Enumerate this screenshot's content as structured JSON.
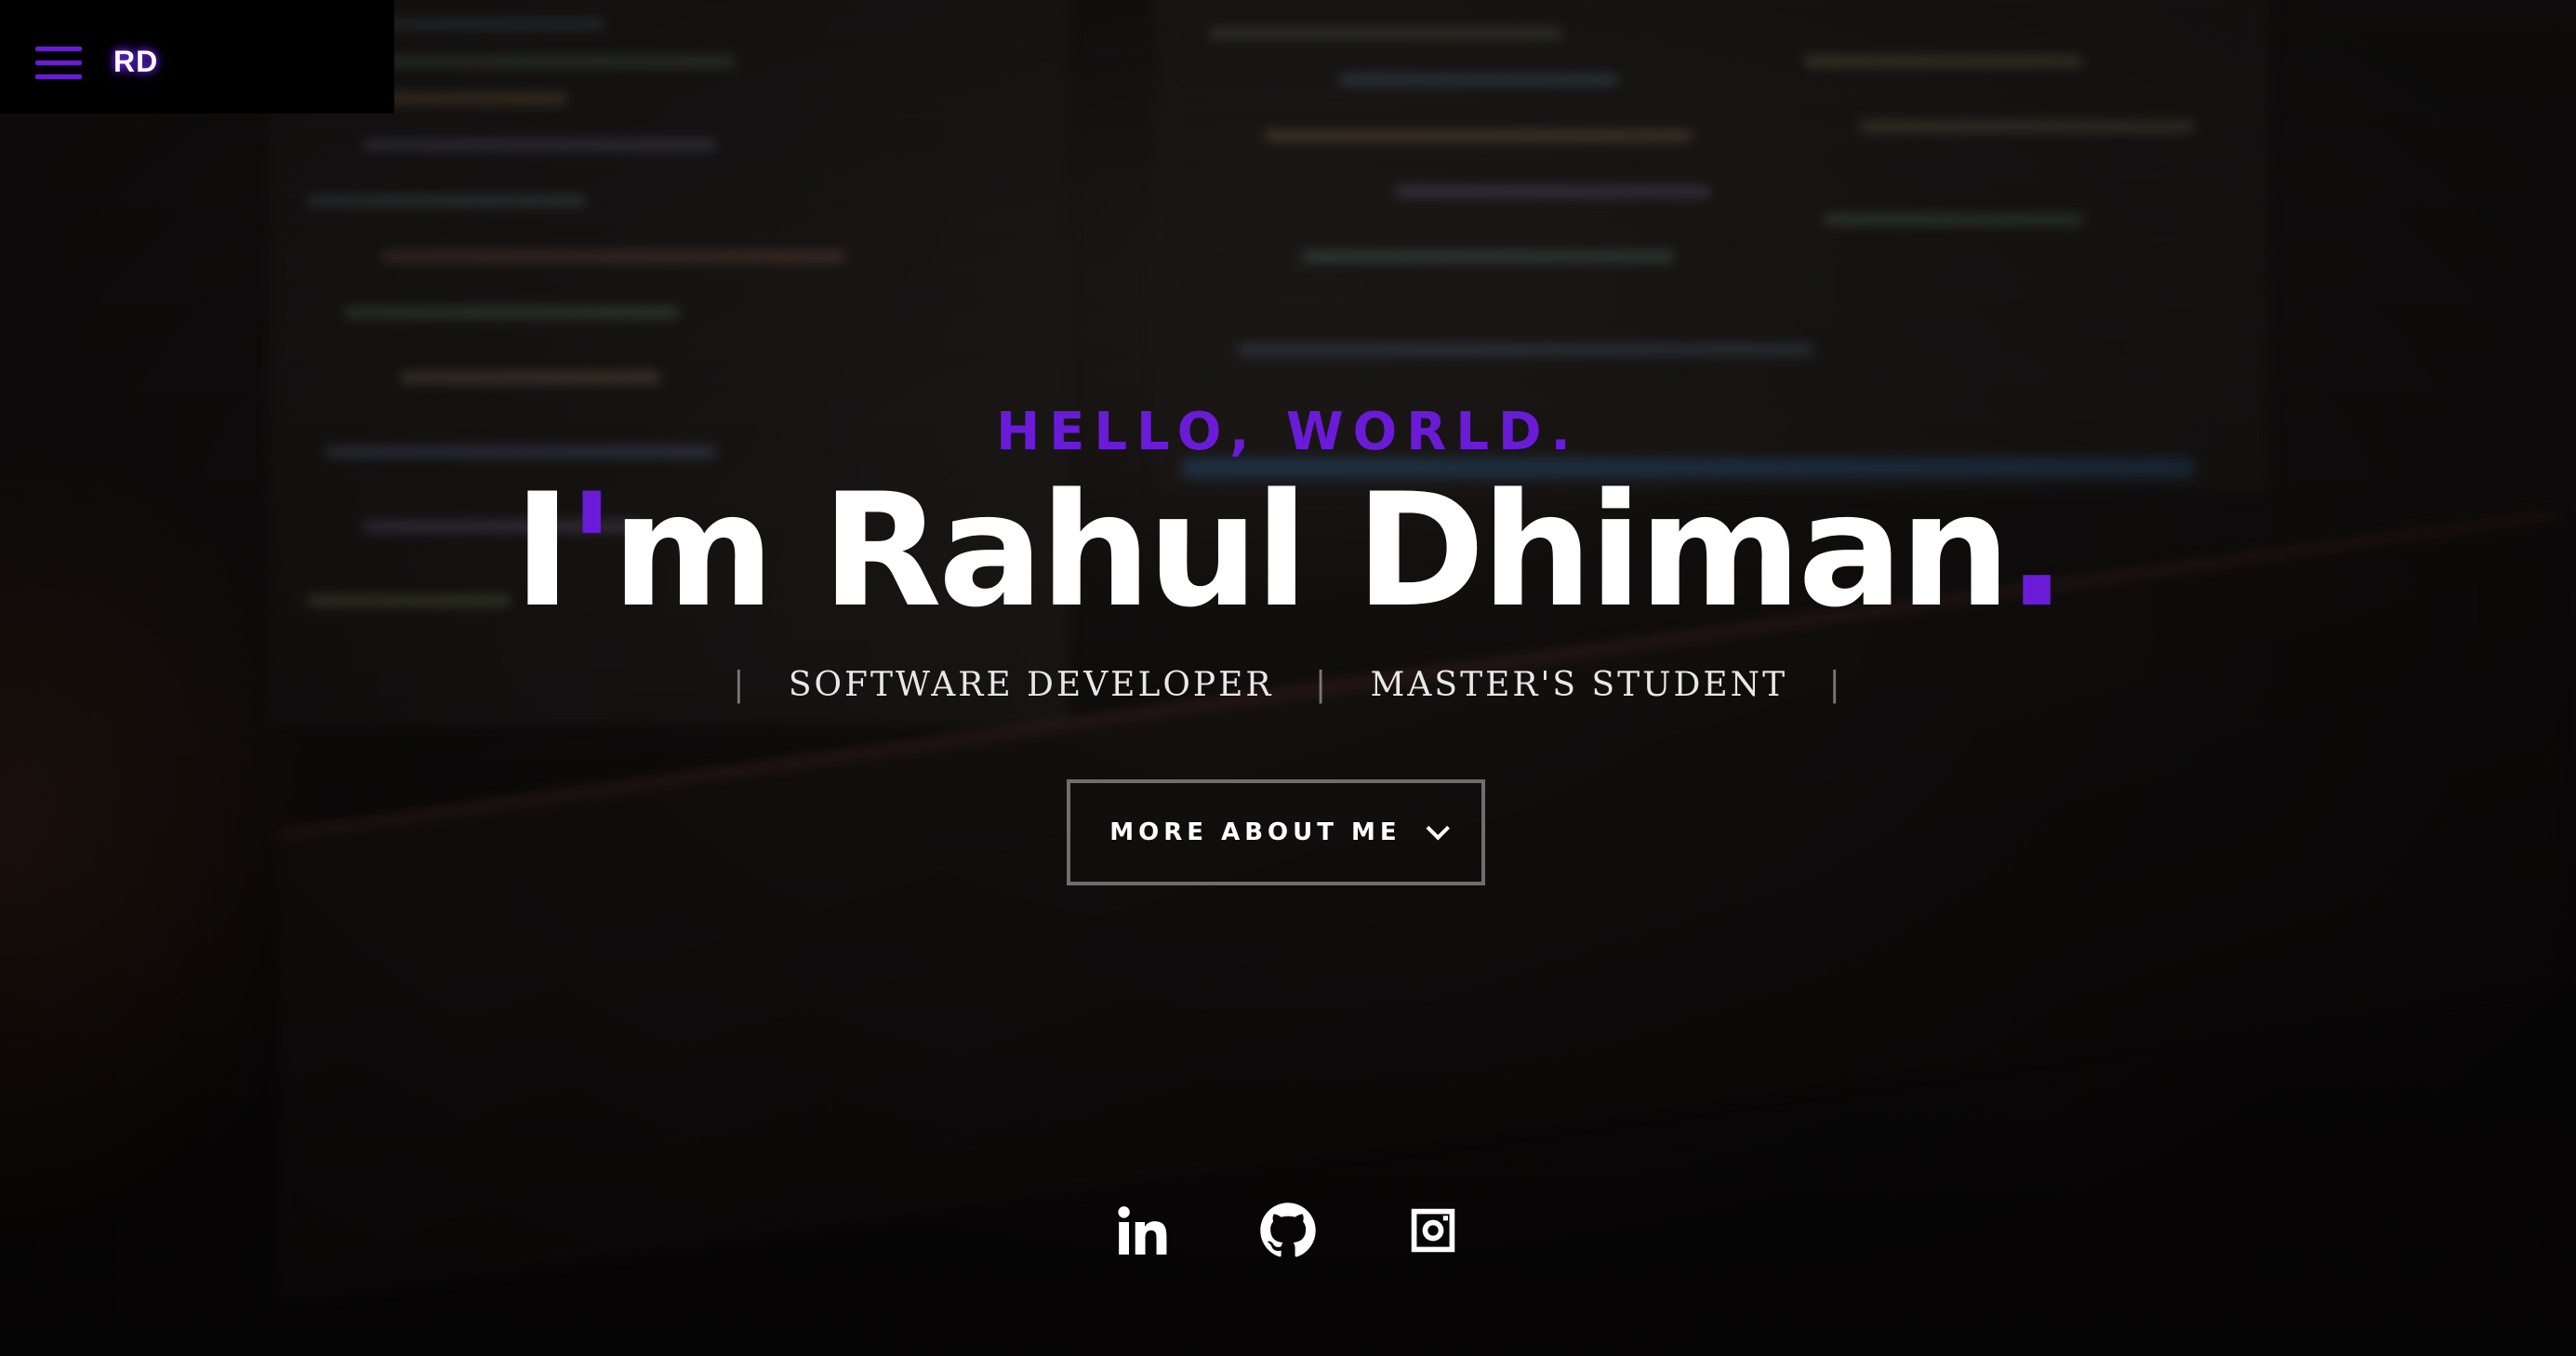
{
  "nav": {
    "logo": "RD",
    "menu_icon": "hamburger-menu-icon"
  },
  "hero": {
    "greeting": "HELLO, WORLD.",
    "name_prefix": "I",
    "name_apostrophe": "'",
    "name_rest": "m Rahul Dhiman",
    "name_dot": ".",
    "roles": [
      "SOFTWARE DEVELOPER",
      "MASTER'S STUDENT"
    ],
    "more_button_label": "MORE ABOUT ME",
    "more_button_icon": "chevron-down-icon"
  },
  "social": [
    {
      "name": "linkedin",
      "icon": "linkedin-icon"
    },
    {
      "name": "github",
      "icon": "github-icon"
    },
    {
      "name": "instagram",
      "icon": "instagram-icon"
    }
  ],
  "colors": {
    "accent": "#6a1bd8",
    "text": "#ffffff",
    "nav_bg": "#000000"
  }
}
